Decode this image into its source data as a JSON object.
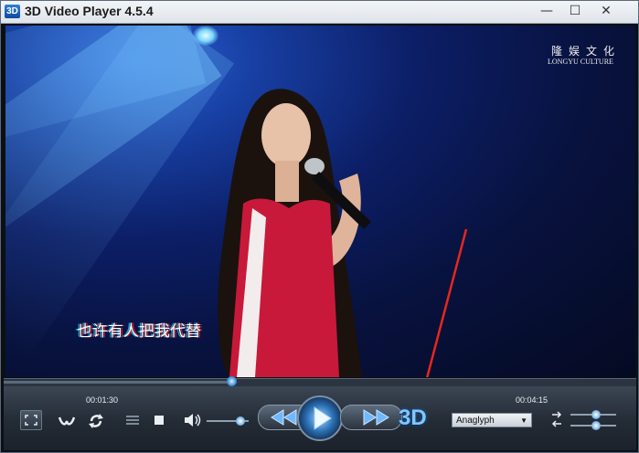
{
  "window": {
    "icon_text": "3D",
    "title": "3D Video Player 4.5.4",
    "minimize_glyph": "—",
    "maximize_glyph": "☐",
    "close_glyph": "✕"
  },
  "video": {
    "logo_text": "隆娱文化",
    "logo_subtext": "LONGYU CULTURE",
    "subtitle": "也许有人把我代替"
  },
  "playback": {
    "elapsed": "00:01:30",
    "duration": "00:04:15",
    "progress_fraction": 0.36,
    "volume_fraction": 0.8
  },
  "controls": {
    "fullscreen_icon": "fullscreen-icon",
    "snapshot_icon": "swap-eye-icon",
    "loop_icon": "loop-icon",
    "playlist_icon": "playlist-icon",
    "stop_icon": "stop-icon",
    "volume_icon": "speaker-icon",
    "rewind_icon": "rewind-icon",
    "play_icon": "play-icon",
    "forward_icon": "fast-forward-icon",
    "threed_label": "3D",
    "mode_selected": "Anaglyph",
    "swap_icon": "swap-lr-icon"
  },
  "colors": {
    "accent": "#3d8fd6",
    "annotation_arrow": "#e8261e"
  }
}
